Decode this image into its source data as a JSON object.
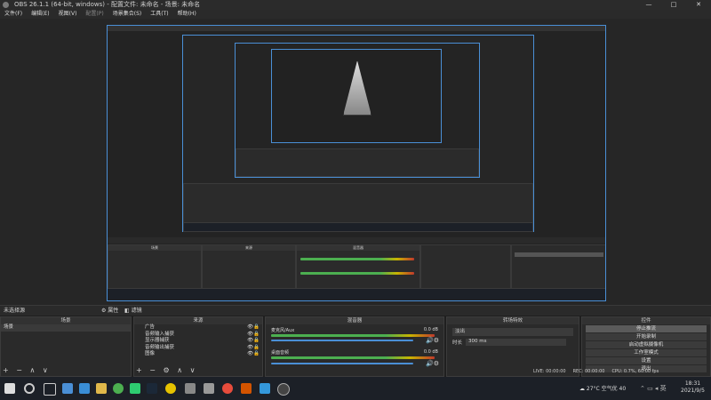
{
  "window": {
    "title": "OBS 26.1.1 (64-bit, windows) - 配置文件: 未命名 - 场景: 未命名",
    "controls": [
      "—",
      "□",
      "✕"
    ]
  },
  "menu": [
    "文件(F)",
    "编辑(E)",
    "视图(V)",
    "配置(P)",
    "场景集合(S)",
    "工具(T)",
    "帮助(H)"
  ],
  "preview": {
    "nested_levels": 4
  },
  "scene_bar": {
    "left": "未选择源",
    "props": "属性",
    "filters": "滤镜"
  },
  "scenes": {
    "title": "场景",
    "items": [
      "场景"
    ],
    "toolbar": "+ − ∧ ∨"
  },
  "sources": {
    "title": "来源",
    "items": [
      "广告",
      "音频输入捕获",
      "显示器捕获",
      "音频输出捕获",
      "图像"
    ],
    "toolbar": "+ − ⚙ ∧ ∨"
  },
  "mixer": {
    "title": "混音器",
    "channels": [
      {
        "name": "麦克风/Aux",
        "db": "0.0 dB",
        "level": 0.82
      },
      {
        "name": "桌面音频",
        "db": "0.0 dB",
        "level": 0.9
      }
    ]
  },
  "transitions": {
    "title": "转场特效",
    "type": "淡出",
    "duration_label": "时长",
    "duration": "300 ms"
  },
  "controls": {
    "title": "控件",
    "buttons": [
      "停止推流",
      "开始录制",
      "启动虚拟摄像机",
      "工作室模式",
      "设置",
      "退出"
    ]
  },
  "status": {
    "live": "LIVE: 00:00:00",
    "rec": "REC: 00:00:00",
    "cpu": "CPU: 0.7%, 60.00 fps",
    "weather": "27°C 空气优 40",
    "time": "18:31",
    "date": "2021/9/5"
  },
  "colors": {
    "accent": "#4a8fd6",
    "meter_green": "#4caf50",
    "meter_yellow": "#c8b400",
    "meter_red": "#c0392b"
  },
  "taskbar_icons": [
    "windows-icon",
    "search-icon",
    "task-view-icon",
    "chat-icon",
    "mail-icon",
    "folder-icon",
    "chrome-icon",
    "wechat-icon",
    "steam-icon",
    "game-icon",
    "explorer-icon",
    "video-icon",
    "app-icon",
    "app2-icon",
    "obs-icon"
  ]
}
